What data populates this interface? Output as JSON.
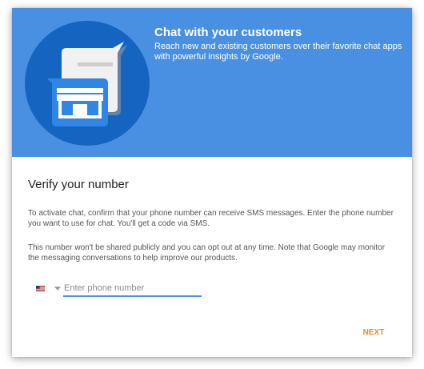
{
  "hero": {
    "title": "Chat with your customers",
    "subtitle": "Reach new and existing customers over their favorite chat apps with powerful insights by Google.",
    "illustration_icons": [
      "chat-bubble-icon",
      "storefront-icon"
    ]
  },
  "verify": {
    "heading": "Verify your number",
    "paragraph_1": "To activate chat, confirm that your phone number can receive SMS messages. Enter the phone number you want to use for chat. You'll get a code via SMS.",
    "paragraph_2": "This number won't be shared publicly and you can opt out at any time. Note that Google may monitor the messaging conversations to help improve our products."
  },
  "phone": {
    "country_icon": "us-flag-icon",
    "value": "",
    "placeholder": "Enter phone number"
  },
  "actions": {
    "next_label": "NEXT"
  },
  "colors": {
    "hero_background": "#4a90e2",
    "illustration_circle": "#1565c0",
    "accent": "#f08a24",
    "input_underline": "#4a90e2"
  }
}
